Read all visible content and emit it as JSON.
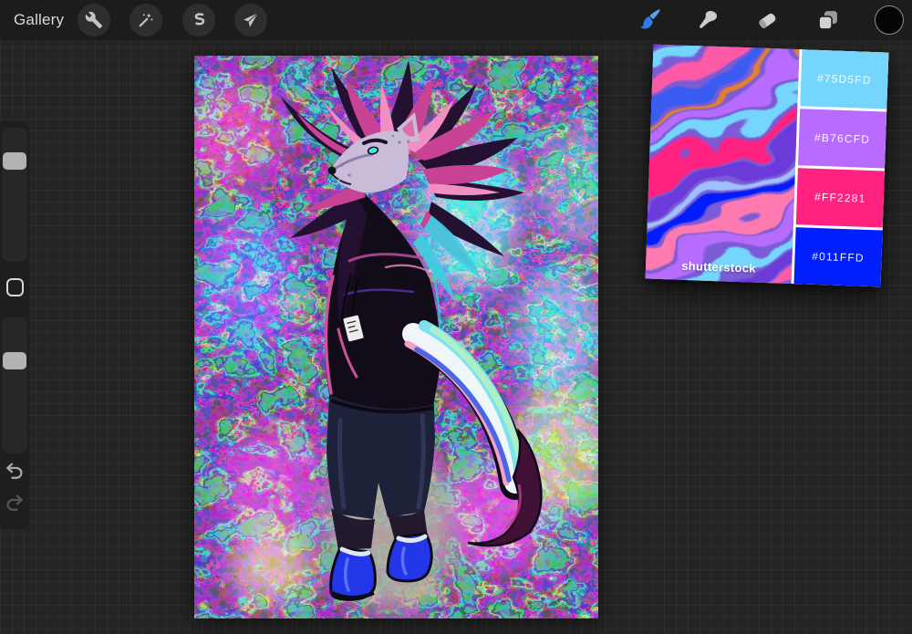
{
  "topbar": {
    "gallery_label": "Gallery",
    "left_tools": [
      {
        "id": "actions",
        "icon": "wrench-icon"
      },
      {
        "id": "adjustments",
        "icon": "magic-wand-icon"
      },
      {
        "id": "selection",
        "icon": "s-curve-icon"
      },
      {
        "id": "transform",
        "icon": "arrow-cursor-icon"
      }
    ],
    "right_tools": [
      {
        "id": "paint",
        "icon": "brush-icon",
        "active": true
      },
      {
        "id": "smudge",
        "icon": "smudge-finger-icon"
      },
      {
        "id": "erase",
        "icon": "eraser-icon"
      },
      {
        "id": "layers",
        "icon": "layers-icon"
      },
      {
        "id": "color",
        "icon": "color-swatch-circle",
        "value": "#000000"
      }
    ],
    "accent_color": "#3D8BF2"
  },
  "sidebar": {
    "controls": [
      "brush-size-slider",
      "modify-button",
      "opacity-slider",
      "undo-arrow-icon",
      "redo-arrow-icon"
    ]
  },
  "reference_panel": {
    "watermark": "shutterstock",
    "swatches": [
      {
        "hex": "#75D5FD"
      },
      {
        "hex": "#B76CFD"
      },
      {
        "hex": "#FF2281"
      },
      {
        "hex": "#011FFD"
      }
    ]
  }
}
